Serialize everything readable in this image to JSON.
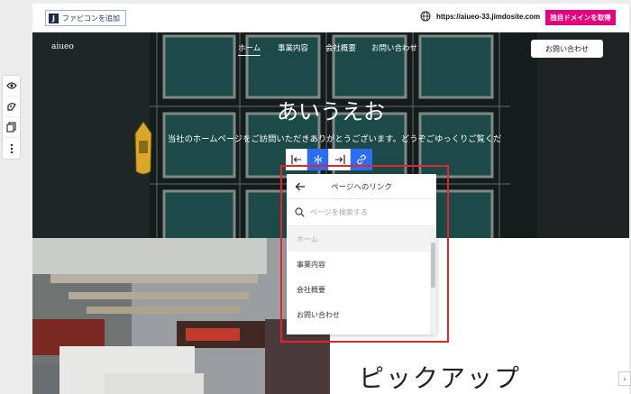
{
  "topbar": {
    "favicon_button": "ファビコンを追加",
    "favicon_letter": "J",
    "site_url": "https://aiueo-33.jimdosite.com",
    "domain_button": "独自ドメインを取得"
  },
  "left_tools": [
    "preview-icon",
    "style-icon",
    "pages-icon",
    "more-icon"
  ],
  "hero": {
    "logo": "aiueo",
    "nav": [
      "ホーム",
      "事業内容",
      "会社概要",
      "お問い合わせ"
    ],
    "contact_button": "お問い合わせ",
    "title": "あいうえお",
    "subtitle": "当社のホームページをご訪問いただきありがとうございます。どうぞごゆっくりご覧くだ"
  },
  "link_toolbar": {
    "buttons": [
      "align-left-icon",
      "align-center-icon",
      "align-right-icon",
      "link-icon"
    ],
    "active_color": "#2b6ef5"
  },
  "link_panel": {
    "title": "ページへのリンク",
    "search_placeholder": "ページを検索する",
    "pages": [
      "ホーム",
      "事業内容",
      "会社概要",
      "お問い合わせ"
    ],
    "current_page": "ホーム"
  },
  "section": {
    "pickup_title": "ピックアップ"
  },
  "colors": {
    "accent_pink": "#e4007f",
    "highlight_red": "#e3262d"
  }
}
